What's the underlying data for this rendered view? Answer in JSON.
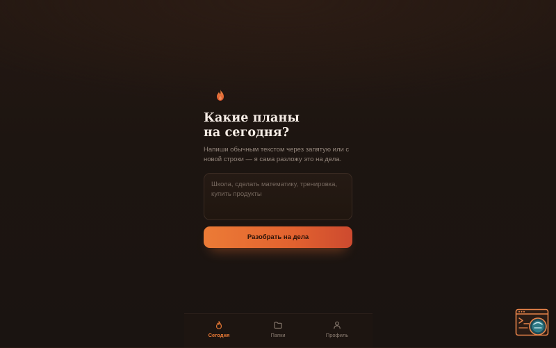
{
  "hero": {
    "title_line1": "Какие планы",
    "title_line2": "на сегодня?",
    "subtitle": "Напиши обычным текстом через запятую или с новой строки — я сама разложу это на дела."
  },
  "input": {
    "value": "",
    "placeholder": "Школа, сделать математику, тренировка, купить продукты"
  },
  "action": {
    "label": "Разобрать на дела"
  },
  "nav": {
    "items": [
      {
        "label": "Сегодня",
        "icon": "flame-icon",
        "active": true
      },
      {
        "label": "Папки",
        "icon": "folder-icon",
        "active": false
      },
      {
        "label": "Профиль",
        "icon": "user-icon",
        "active": false
      }
    ]
  },
  "colors": {
    "accent": "#ec7b36",
    "accent_end": "#cd4a2f",
    "background": "#1c1411",
    "text": "#f6ede6",
    "muted": "#93857b"
  }
}
